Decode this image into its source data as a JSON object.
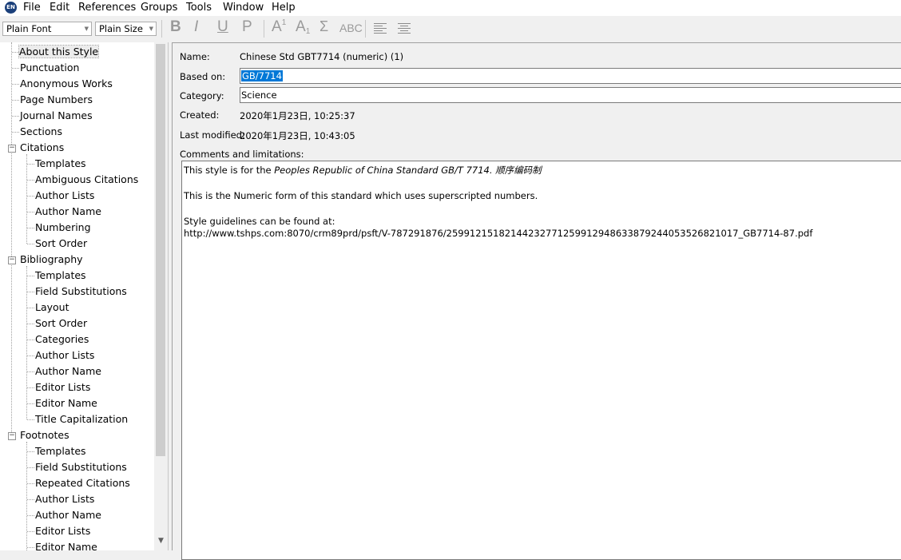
{
  "app": {
    "icon_text": "EN"
  },
  "menubar": {
    "items": [
      "File",
      "Edit",
      "References",
      "Groups",
      "Tools",
      "Window",
      "Help"
    ]
  },
  "toolbar": {
    "font_combo": "Plain Font",
    "size_combo": "Plain Size",
    "bold": "B",
    "italic": "I",
    "underline": "U",
    "plain": "P",
    "superscript": "A",
    "superscript_mark": "1",
    "subscript": "A",
    "subscript_mark": "1",
    "symbol": "Σ",
    "smallcaps": "ABC"
  },
  "sidebar": {
    "items": [
      {
        "label": "About this Style",
        "level": 0
      },
      {
        "label": "Punctuation",
        "level": 0
      },
      {
        "label": "Anonymous Works",
        "level": 0
      },
      {
        "label": "Page Numbers",
        "level": 0
      },
      {
        "label": "Journal Names",
        "level": 0
      },
      {
        "label": "Sections",
        "level": 0
      },
      {
        "label": "Citations",
        "level": 0
      },
      {
        "label": "Templates",
        "level": 1
      },
      {
        "label": "Ambiguous Citations",
        "level": 1
      },
      {
        "label": "Author Lists",
        "level": 1
      },
      {
        "label": "Author Name",
        "level": 1
      },
      {
        "label": "Numbering",
        "level": 1
      },
      {
        "label": "Sort Order",
        "level": 1
      },
      {
        "label": "Bibliography",
        "level": 0
      },
      {
        "label": "Templates",
        "level": 1
      },
      {
        "label": "Field Substitutions",
        "level": 1
      },
      {
        "label": "Layout",
        "level": 1
      },
      {
        "label": "Sort Order",
        "level": 1
      },
      {
        "label": "Categories",
        "level": 1
      },
      {
        "label": "Author Lists",
        "level": 1
      },
      {
        "label": "Author Name",
        "level": 1
      },
      {
        "label": "Editor Lists",
        "level": 1
      },
      {
        "label": "Editor Name",
        "level": 1
      },
      {
        "label": "Title Capitalization",
        "level": 1
      },
      {
        "label": "Footnotes",
        "level": 0
      },
      {
        "label": "Templates",
        "level": 1
      },
      {
        "label": "Field Substitutions",
        "level": 1
      },
      {
        "label": "Repeated Citations",
        "level": 1
      },
      {
        "label": "Author Lists",
        "level": 1
      },
      {
        "label": "Author Name",
        "level": 1
      },
      {
        "label": "Editor Lists",
        "level": 1
      },
      {
        "label": "Editor Name",
        "level": 1
      }
    ],
    "expander_symbol": "−",
    "scroll_down_arrow": "▼"
  },
  "form": {
    "name_label": "Name:",
    "name_value": "Chinese Std GBT7714 (numeric) (1)",
    "based_on_label": "Based on:",
    "based_on_value": "GB/7714",
    "category_label": "Category:",
    "category_value": "Science",
    "created_label": "Created:",
    "created_value": "2020年1月23日, 10:25:37",
    "modified_label": "Last modified:",
    "modified_value": "2020年1月23日, 10:43:05",
    "comments_label": "Comments and limitations:",
    "comments": {
      "line1_prefix": "This style is for the ",
      "line1_italic": "Peoples Republic of China Standard GB/T 7714.  顺序编码制",
      "line2": "This is the Numeric form of this standard which uses superscripted numbers.",
      "line3": "Style guidelines can be found at:",
      "line4": "http://www.tshps.com:8070/crm89prd/psft/V-787291876/25991215182144232771259912948633879244053526821017_GB7714-87.pdf"
    }
  }
}
